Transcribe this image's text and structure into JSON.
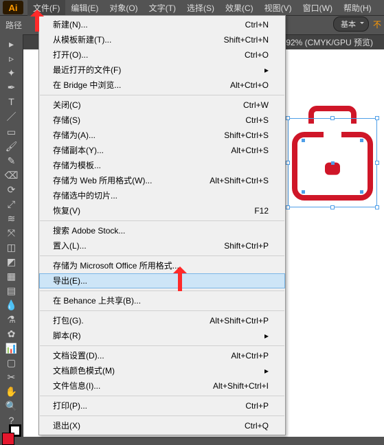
{
  "app_icon": "Ai",
  "menubar": [
    {
      "label": "文件(F)",
      "active": true
    },
    {
      "label": "编辑(E)"
    },
    {
      "label": "对象(O)"
    },
    {
      "label": "文字(T)"
    },
    {
      "label": "选择(S)"
    },
    {
      "label": "效果(C)"
    },
    {
      "label": "视图(V)"
    },
    {
      "label": "窗口(W)"
    },
    {
      "label": "帮助(H)"
    }
  ],
  "toolbar": {
    "path_label": "路径",
    "style_label": "基本",
    "opacity_label": "不"
  },
  "document_tab": "92% (CMYK/GPU 预览)",
  "dropdown": {
    "groups": [
      [
        {
          "label": "新建(N)...",
          "shortcut": "Ctrl+N"
        },
        {
          "label": "从模板新建(T)...",
          "shortcut": "Shift+Ctrl+N"
        },
        {
          "label": "打开(O)...",
          "shortcut": "Ctrl+O"
        },
        {
          "label": "最近打开的文件(F)",
          "shortcut": "",
          "submenu": true
        },
        {
          "label": "在 Bridge 中浏览...",
          "shortcut": "Alt+Ctrl+O"
        }
      ],
      [
        {
          "label": "关闭(C)",
          "shortcut": "Ctrl+W"
        },
        {
          "label": "存储(S)",
          "shortcut": "Ctrl+S"
        },
        {
          "label": "存储为(A)...",
          "shortcut": "Shift+Ctrl+S"
        },
        {
          "label": "存储副本(Y)...",
          "shortcut": "Alt+Ctrl+S"
        },
        {
          "label": "存储为模板...",
          "shortcut": ""
        },
        {
          "label": "存储为 Web 所用格式(W)...",
          "shortcut": "Alt+Shift+Ctrl+S"
        },
        {
          "label": "存储选中的切片...",
          "shortcut": ""
        },
        {
          "label": "恢复(V)",
          "shortcut": "F12"
        }
      ],
      [
        {
          "label": "搜索 Adobe Stock...",
          "shortcut": ""
        },
        {
          "label": "置入(L)...",
          "shortcut": "Shift+Ctrl+P"
        }
      ],
      [
        {
          "label": "存储为 Microsoft Office 所用格式...",
          "shortcut": ""
        },
        {
          "label": "导出(E)...",
          "shortcut": "",
          "highlight": true
        }
      ],
      [
        {
          "label": "在 Behance 上共享(B)...",
          "shortcut": ""
        }
      ],
      [
        {
          "label": "打包(G).",
          "shortcut": "Alt+Shift+Ctrl+P"
        },
        {
          "label": "脚本(R)",
          "shortcut": "",
          "submenu": true
        }
      ],
      [
        {
          "label": "文档设置(D)...",
          "shortcut": "Alt+Ctrl+P"
        },
        {
          "label": "文档颜色模式(M)",
          "shortcut": "",
          "submenu": true
        },
        {
          "label": "文件信息(I)...",
          "shortcut": "Alt+Shift+Ctrl+I"
        }
      ],
      [
        {
          "label": "打印(P)...",
          "shortcut": "Ctrl+P"
        }
      ],
      [
        {
          "label": "退出(X)",
          "shortcut": "Ctrl+Q"
        }
      ]
    ]
  },
  "tools": [
    "selection",
    "direct-select",
    "wand",
    "pen",
    "type",
    "line",
    "rect",
    "brush",
    "pencil",
    "eraser",
    "rotate",
    "scale",
    "width",
    "free-transform",
    "shape-builder",
    "perspective",
    "mesh",
    "gradient",
    "eyedropper",
    "blend",
    "symbol",
    "graph",
    "artboard",
    "slice",
    "hand",
    "zoom",
    "question"
  ]
}
